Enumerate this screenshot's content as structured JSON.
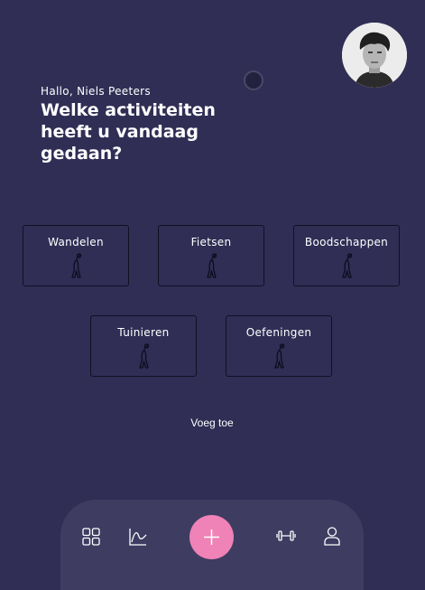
{
  "header": {
    "greeting": "Hallo, Niels Peeters",
    "question": "Welke activiteiten heeft u vandaag gedaan?"
  },
  "activities": [
    {
      "label": "Wandelen",
      "icon": "stretching-person-icon"
    },
    {
      "label": "Fietsen",
      "icon": "stretching-person-icon"
    },
    {
      "label": "Boodschappen",
      "icon": "stretching-person-icon"
    },
    {
      "label": "Tuinieren",
      "icon": "stretching-person-icon"
    },
    {
      "label": "Oefeningen",
      "icon": "stretching-person-icon"
    }
  ],
  "add_label": "Voeg toe",
  "nav": {
    "items": [
      "grid-icon",
      "chart-icon",
      "plus-icon",
      "dumbbell-icon",
      "user-icon"
    ]
  },
  "colors": {
    "background": "#302e55",
    "navbar": "#3e3c61",
    "fab": "#ef82b6"
  }
}
